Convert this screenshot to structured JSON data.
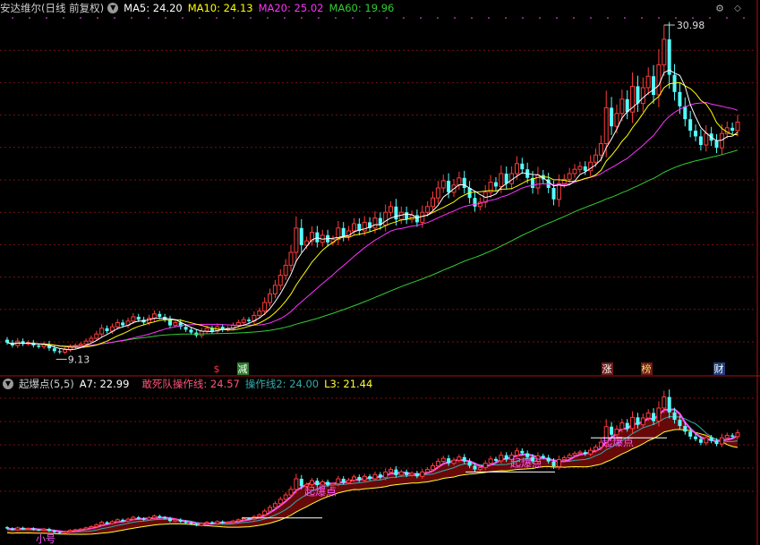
{
  "main": {
    "title": "安达维尔(日线 前复权)",
    "ma": [
      {
        "label": "MA5: 24.20",
        "color": "#ffffff"
      },
      {
        "label": "MA10: 24.13",
        "color": "#ffff00"
      },
      {
        "label": "MA20: 25.02",
        "color": "#ff33ff"
      },
      {
        "label": "MA60: 19.96",
        "color": "#33cc33"
      }
    ],
    "high_label": "30.98",
    "low_label": "9.13",
    "markers": [
      {
        "text": "$",
        "color": "#ff3333",
        "bg": "#000000"
      },
      {
        "text": "减",
        "color": "#ffffff",
        "bg": "#2c7a2c"
      },
      {
        "text": "涨",
        "color": "#ffffff",
        "bg": "#6b1a1a"
      },
      {
        "text": "榜",
        "color": "#ffdd66",
        "bg": "#6b1a1a"
      },
      {
        "text": "财",
        "color": "#ffffff",
        "bg": "#1f3d7a"
      }
    ]
  },
  "sub": {
    "title": "起爆点(5,5)",
    "indicators": [
      {
        "label": "A7: 22.99",
        "color": "#ffffff"
      },
      {
        "label": "敢死队操作线: 24.57",
        "color": "#ff5577"
      },
      {
        "label": "操作线2: 24.00",
        "color": "#33aaaa"
      },
      {
        "label": "L3: 21.44",
        "color": "#ffff33"
      }
    ],
    "annotations": [
      "起爆点",
      "起爆点",
      "起爆点"
    ],
    "bottom_left": "小号"
  },
  "colors": {
    "up": "#ff3c3c",
    "down": "#54ffff",
    "grid": "#7a1010",
    "ma5": "#ffffff",
    "ma10": "#ffff00",
    "ma20": "#ff33ff",
    "ma60": "#33cc33",
    "fill": "#7a0a0a",
    "l3": "#ffff33"
  },
  "chart_data": {
    "type": "candlestick",
    "series_closes": [
      9.8,
      9.6,
      9.9,
      9.7,
      9.8,
      9.6,
      9.5,
      9.7,
      9.4,
      9.2,
      9.13,
      9.3,
      9.5,
      9.6,
      9.7,
      9.9,
      10.1,
      10.4,
      10.8,
      10.6,
      10.9,
      11.2,
      11.0,
      11.3,
      11.6,
      11.4,
      11.2,
      11.5,
      11.8,
      11.6,
      11.4,
      11.0,
      11.2,
      10.9,
      10.7,
      10.5,
      10.3,
      10.6,
      10.8,
      10.6,
      10.9,
      10.7,
      10.8,
      11.0,
      11.2,
      11.4,
      11.3,
      11.7,
      12.0,
      12.6,
      13.2,
      13.8,
      14.5,
      15.2,
      16.1,
      17.8,
      16.6,
      16.9,
      17.5,
      16.8,
      17.3,
      16.8,
      17.0,
      17.8,
      17.2,
      17.6,
      18.1,
      17.6,
      18.2,
      17.8,
      18.5,
      18.0,
      18.9,
      19.3,
      18.4,
      18.9,
      18.4,
      18.7,
      18.2,
      18.9,
      19.3,
      19.9,
      20.6,
      21.1,
      20.3,
      20.8,
      21.3,
      20.6,
      19.9,
      19.3,
      19.6,
      20.3,
      21.0,
      20.7,
      21.6,
      20.9,
      21.6,
      22.3,
      21.9,
      21.3,
      20.6,
      21.5,
      21.2,
      20.6,
      19.8,
      20.9,
      21.2,
      21.6,
      21.9,
      22.1,
      21.8,
      22.4,
      22.9,
      23.7,
      26.2,
      24.9,
      25.8,
      26.8,
      25.9,
      27.7,
      26.5,
      27.6,
      28.4,
      27.1,
      29.2,
      30.98,
      28.5,
      27.3,
      26.3,
      25.4,
      24.6,
      24.2,
      23.6,
      24.4,
      23.9,
      23.4,
      24.4,
      24.8,
      24.6,
      25.2
    ],
    "series_ohlc_note": "values in price units (RMB); open/high/low derived approximately",
    "ma_labels": {
      "MA5": 24.2,
      "MA10": 24.13,
      "MA20": 25.02,
      "MA60": 19.96
    },
    "extremes": {
      "high": 30.98,
      "low": 9.13
    },
    "indicator_labels": {
      "A7": 22.99,
      "敢死队操作线": 24.57,
      "操作线2": 24.0,
      "L3": 21.44
    },
    "annotations_sub": [
      "起爆点",
      "起爆点",
      "起爆点"
    ]
  }
}
